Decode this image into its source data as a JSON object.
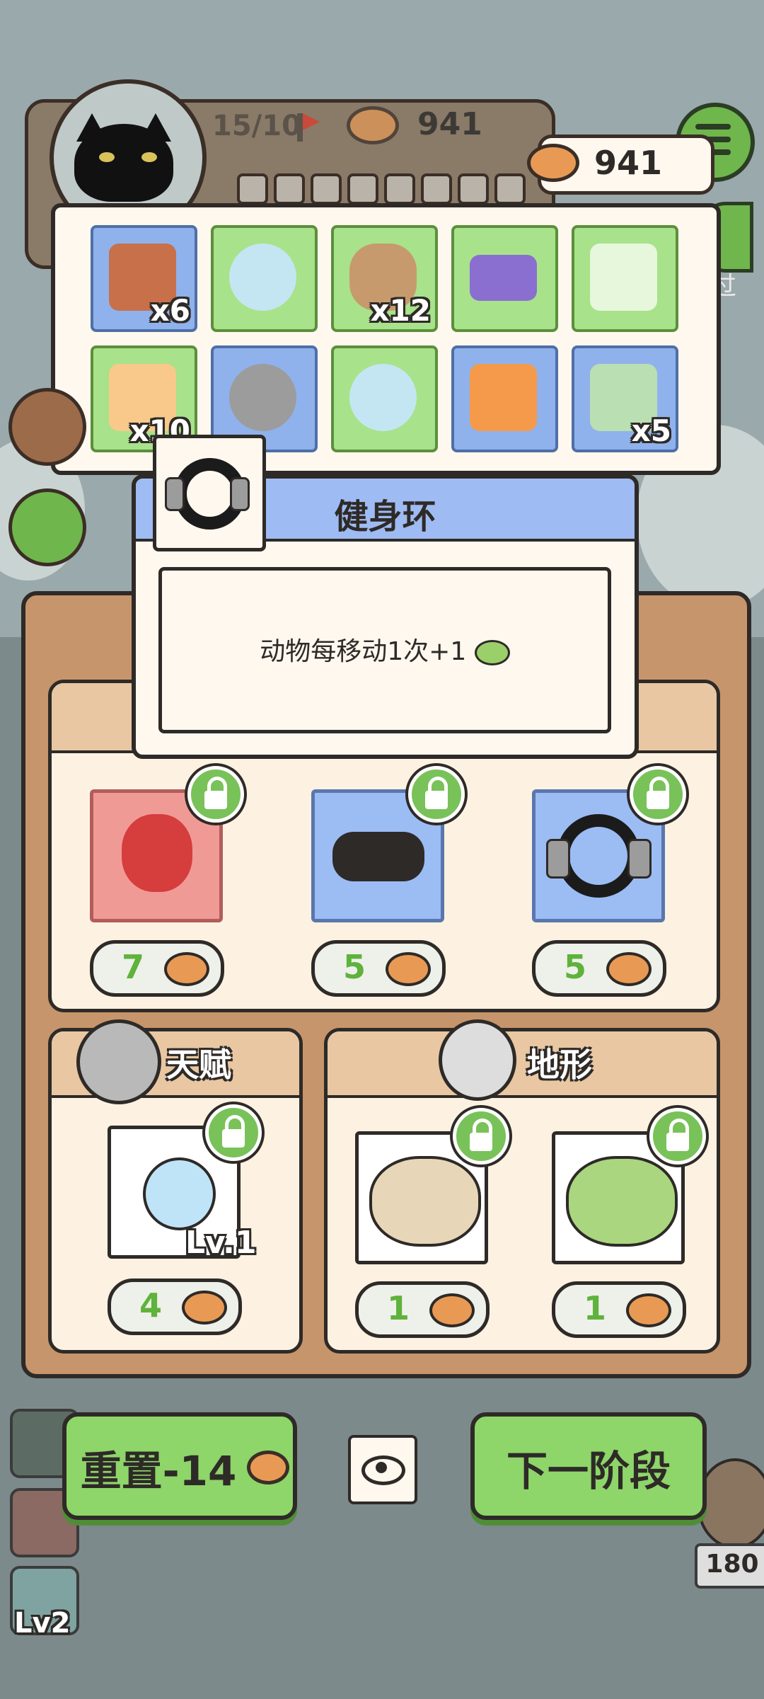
{
  "hud": {
    "moves": "15/10",
    "currency_back": "941",
    "currency_front": "941",
    "skip_label": "过"
  },
  "inventory": [
    {
      "name": "chimney-fire",
      "count": "x6",
      "color": "blue"
    },
    {
      "name": "snow-globe",
      "count": "",
      "color": "green"
    },
    {
      "name": "coffee-cup",
      "count": "x12",
      "color": "green"
    },
    {
      "name": "credit-card",
      "count": "",
      "color": "green"
    },
    {
      "name": "ticket",
      "count": "",
      "color": "green"
    },
    {
      "name": "refresh-ticket",
      "count": "x10",
      "color": "green"
    },
    {
      "name": "windup-mouse",
      "count": "",
      "color": "blue"
    },
    {
      "name": "snow-globe",
      "count": "",
      "color": "green"
    },
    {
      "name": "minus-one-card",
      "count": "",
      "color": "blue"
    },
    {
      "name": "clover-charm",
      "count": "x5",
      "color": "blue"
    }
  ],
  "tooltip": {
    "title": "健身环",
    "description": "动物每移动1次+1"
  },
  "shop": {
    "items": [
      {
        "name": "gift-bag",
        "price": "7"
      },
      {
        "name": "binoculars",
        "price": "5"
      },
      {
        "name": "fitness-ring",
        "price": "5"
      }
    ],
    "talent": {
      "title": "天赋",
      "level": "Lv.1",
      "price": "4"
    },
    "terrain": {
      "title": "地形",
      "prices": [
        "1",
        "1"
      ]
    }
  },
  "buttons": {
    "reset": "重置-14",
    "next": "下一阶段"
  },
  "side": {
    "bottom_level": "Lv2",
    "right_count": "180"
  },
  "colors": {
    "green_slot": "#a8e28b",
    "blue_slot": "#8fb2ec",
    "price_green": "#5fb23b",
    "button_green": "#8ed56a"
  }
}
